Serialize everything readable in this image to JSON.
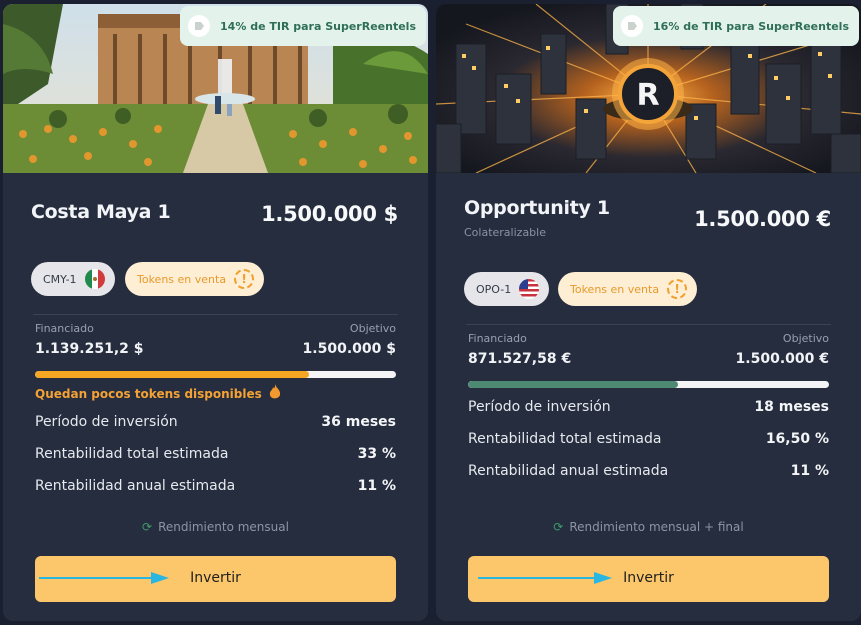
{
  "cards": [
    {
      "irr_badge": "14% de TIR para SuperReentels",
      "title": "Costa Maya 1",
      "subtitle": "",
      "price": "1.500.000 $",
      "code_chip": "CMY-1",
      "flag": "mexico-flag",
      "status_chip": "Tokens en venta",
      "funded_label": "Financiado",
      "funded_value": "1.139.251,2 $",
      "goal_label": "Objetivo",
      "goal_value": "1.500.000 $",
      "progress_fraction": 0.7595,
      "progress_color": "#f5a623",
      "warning": "Quedan pocos tokens disponibles",
      "rows": [
        {
          "label": "Período de inversión",
          "value": "36 meses"
        },
        {
          "label": "Rentabilidad total estimada",
          "value": "33 %"
        },
        {
          "label": "Rentabilidad anual estimada",
          "value": "11 %"
        }
      ],
      "payout": "Rendimiento mensual",
      "button": "Invertir"
    },
    {
      "irr_badge": "16% de TIR para SuperReentels",
      "title": "Opportunity 1",
      "subtitle": "Colateralizable",
      "price": "1.500.000 €",
      "code_chip": "OPO-1",
      "flag": "usa-flag",
      "status_chip": "Tokens en venta",
      "funded_label": "Financiado",
      "funded_value": "871.527,58 €",
      "goal_label": "Objetivo",
      "goal_value": "1.500.000 €",
      "progress_fraction": 0.581,
      "progress_color": "#4e8a73",
      "warning": "",
      "rows": [
        {
          "label": "Período de inversión",
          "value": "18 meses"
        },
        {
          "label": "Rentabilidad total estimada",
          "value": "16,50 %"
        },
        {
          "label": "Rentabilidad anual estimada",
          "value": "11 %"
        }
      ],
      "payout": "Rendimiento mensual + final",
      "button": "Invertir"
    }
  ],
  "colors": {
    "accent": "#fcc76a",
    "background": "#1a2030",
    "card": "#252d3e"
  }
}
